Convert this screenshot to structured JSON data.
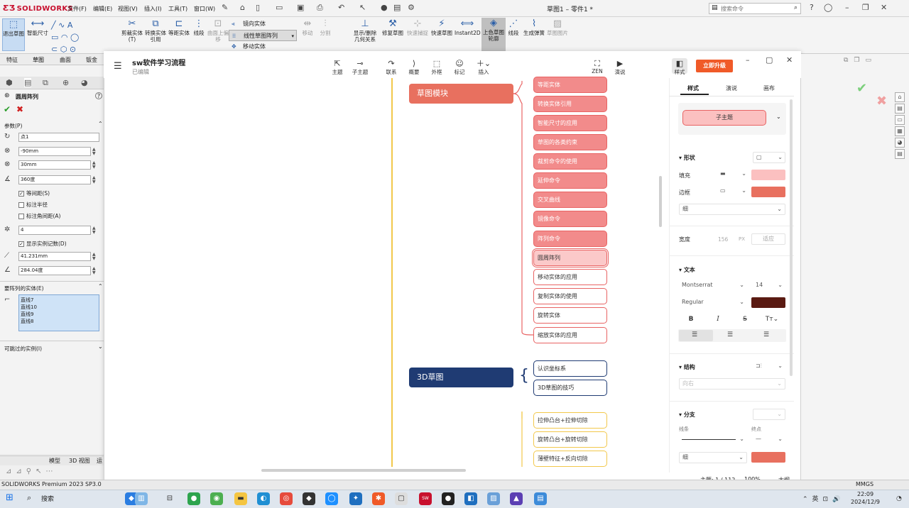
{
  "sw": {
    "logo": "SOLIDWORKS",
    "menus": [
      "文件(F)",
      "编辑(E)",
      "视图(V)",
      "插入(I)",
      "工具(T)",
      "窗口(W)"
    ],
    "doc_title": "草图1 – 零件1 *",
    "search_placeholder": "搜索命令",
    "ribbon": {
      "exit_sketch": "退出草图",
      "smart_dim": "智能尺寸",
      "trim": "剪裁实体(T)",
      "convert": "转换实体引用",
      "offset": "等距实体",
      "segment": "线段",
      "surface_offset": "曲面上偏移",
      "mirror": "镜向实体",
      "linear_pattern": "线性草图阵列",
      "move": "移动实体",
      "move_dim": "移动",
      "split": "分割",
      "show_delete": "显示/删除几何关系",
      "repair": "修复草图",
      "quick_snap": "快速捕捉",
      "quick_sketch": "快速草图",
      "instant2d": "Instant2D",
      "color_sketch": "上色草图轮廓",
      "segment2": "线段",
      "gen_spring": "生成弹簧",
      "sketch_pic": "草图图片"
    },
    "tabs": [
      "特征",
      "草图",
      "曲面",
      "钣金"
    ],
    "pm": {
      "title": "圆周阵列",
      "params_label": "参数(P)",
      "point_value": "点1",
      "x_value": "-90mm",
      "y_value": "30mm",
      "angle_value": "360度",
      "equal_spacing": "等间距(S)",
      "dim_radius": "标注半径",
      "dim_angle": "标注角间距(A)",
      "count_value": "4",
      "show_count": "显示实例记数(D)",
      "radius_value": "41.231mm",
      "arc_angle_value": "284.04度",
      "entities_label": "要阵列的实体(E)",
      "entities": [
        "直线7",
        "直线10",
        "直线9",
        "直线8"
      ],
      "skip_label": "可跳过的实例(I)"
    },
    "bottom_tabs": [
      "模型",
      "3D 视图",
      "运"
    ],
    "status": "SOLIDWORKS Premium 2023 SP3.0",
    "status_right": "MMGS"
  },
  "mm": {
    "title": "sw软件学习流程",
    "status": "已编辑",
    "tools": {
      "topic": "主题",
      "subtopic": "子主题",
      "relation": "联系",
      "summary": "概要",
      "boundary": "外框",
      "marker": "标记",
      "insert": "插入",
      "zen": "ZEN",
      "present": "演说",
      "style": "样式"
    },
    "upgrade": "立即升级",
    "main_nodes": [
      {
        "label": "草图模块",
        "color": "#e8705f"
      },
      {
        "label": "3D草图",
        "color": "#1f3b73"
      }
    ],
    "sketch_children": [
      "等距实体",
      "转换实体引用",
      "智能尺寸的应用",
      "草图的各类约束",
      "裁剪命令的使用",
      "延伸命令",
      "交叉曲线",
      "镜像命令",
      "阵列命令",
      "圆周阵列",
      "移动实体的应用",
      "复制实体的使用",
      "旋转实体",
      "缩放实体的应用"
    ],
    "sketch3d_children": [
      "认识坐标系",
      "3D草图的技巧"
    ],
    "feature_children": [
      "拉伸凸台+拉伸切除",
      "旋转凸台+旋转切除",
      "薄壁特征+反向切除"
    ],
    "panel": {
      "tabs": [
        "样式",
        "演说",
        "画布"
      ],
      "preview": "子主题",
      "shape": "形状",
      "fill": "填充",
      "border": "边框",
      "border_weight": "细",
      "width": "宽度",
      "width_value": "156",
      "width_unit": "PX",
      "fit": "适应",
      "text": "文本",
      "font": "Montserrat",
      "font_size": "14",
      "font_weight": "Regular",
      "structure": "结构",
      "structure_value": "向右",
      "branch": "分支",
      "line": "线条",
      "endpoint": "终点",
      "branch_weight": "细",
      "fill_color": "#fbc0c0",
      "border_color": "#e8705f",
      "text_color": "#5a1a12",
      "branch_color": "#e8705f"
    },
    "footer": {
      "topics": "主题: 1 / 112",
      "zoom": "100%",
      "outline": "大纲"
    }
  },
  "taskbar": {
    "search": "搜索",
    "time": "22:09",
    "date": "2024/12/9"
  }
}
